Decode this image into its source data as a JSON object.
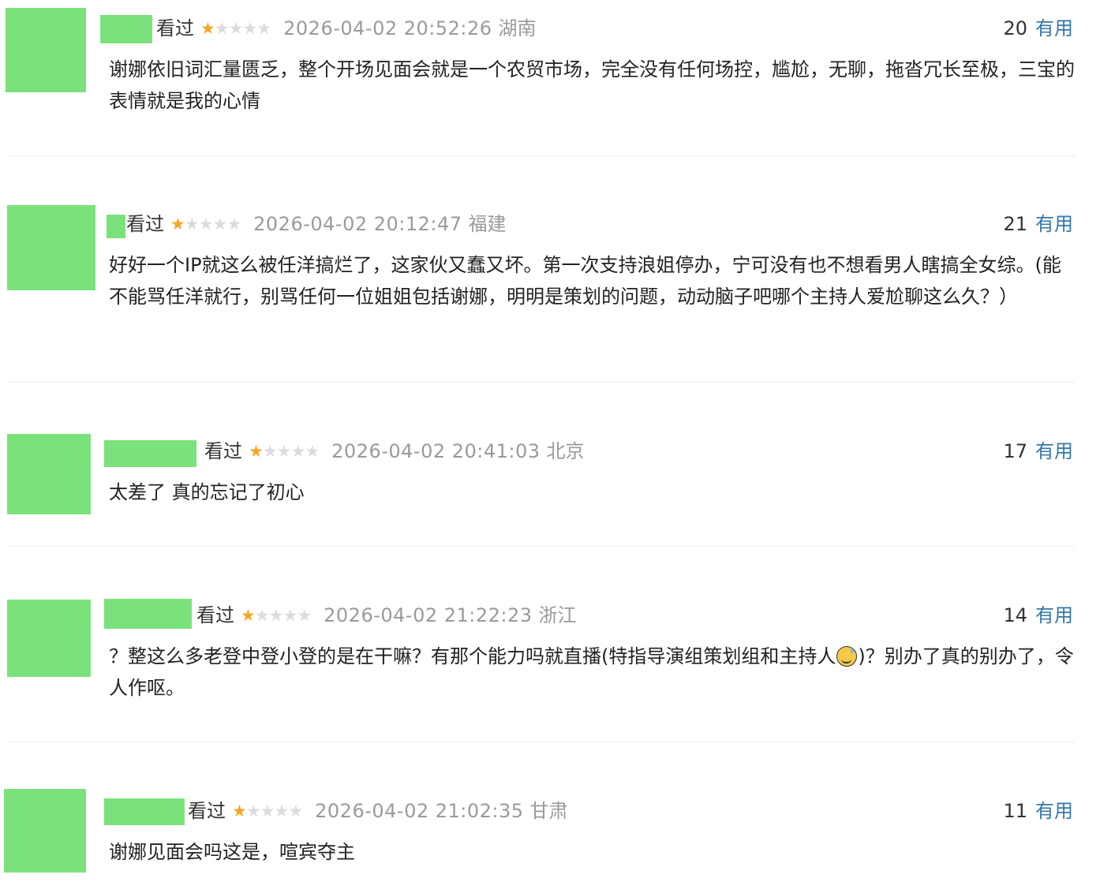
{
  "colors": {
    "avatar_mask": "#7be27b",
    "star_on": "#f5a623",
    "star_off": "#dcdcdc",
    "link": "#3377aa",
    "meta_gray": "#9a9a9a",
    "text": "#222222"
  },
  "reviews": [
    {
      "status": "看过",
      "rating": 1,
      "max_rating": 5,
      "time": "2026-04-02 20:52:26",
      "region": "湖南",
      "votes": "20",
      "useful_label": "有用",
      "content": "谢娜依旧词汇量匮乏，整个开场见面会就是一个农贸市场，完全没有任何场控，尴尬，无聊，拖沓冗长至极，三宝的表情就是我的心情"
    },
    {
      "status": "看过",
      "rating": 1,
      "max_rating": 5,
      "time": "2026-04-02 20:12:47",
      "region": "福建",
      "votes": "21",
      "useful_label": "有用",
      "content": "好好一个IP就这么被任洋搞烂了，这家伙又蠢又坏。第一次支持浪姐停办，宁可没有也不想看男人瞎搞全女综。(能不能骂任洋就行，别骂任何一位姐姐包括谢娜，明明是策划的问题，动动脑子吧哪个主持人爱尬聊这么久？）"
    },
    {
      "status": "看过",
      "rating": 1,
      "max_rating": 5,
      "time": "2026-04-02 20:41:03",
      "region": "北京",
      "votes": "17",
      "useful_label": "有用",
      "content": "太差了 真的忘记了初心"
    },
    {
      "status": "看过",
      "rating": 1,
      "max_rating": 5,
      "time": "2026-04-02 21:22:23",
      "region": "浙江",
      "votes": "14",
      "useful_label": "有用",
      "content_before_emoji": "？整这么多老登中登小登的是在干嘛？有那个能力吗就直播(特指导演组策划组和主持人",
      "emoji": "sweat-smile-emoji",
      "content_after_emoji": ")？别办了真的别办了，令人作呕。"
    },
    {
      "status": "看过",
      "rating": 1,
      "max_rating": 5,
      "time": "2026-04-02 21:02:35",
      "region": "甘肃",
      "votes": "11",
      "useful_label": "有用",
      "content": "谢娜见面会吗这是，喧宾夺主"
    }
  ]
}
